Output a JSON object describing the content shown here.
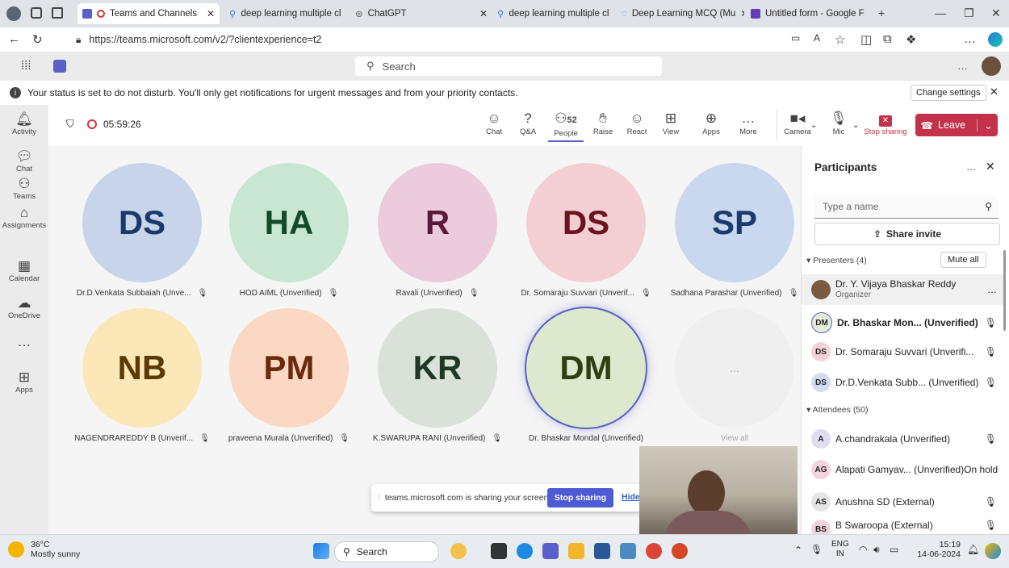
{
  "browser": {
    "tabs": [
      {
        "label": "Teams and Channels",
        "color": "#5b5fc7"
      },
      {
        "label": "deep learning multiple cl",
        "color": "#2a7de1"
      },
      {
        "label": "ChatGPT",
        "color": "#888888"
      },
      {
        "label": "deep learning multiple cl",
        "color": "#2a7de1"
      },
      {
        "label": "Deep Learning MCQ (Mu",
        "color": "#2a7de1"
      },
      {
        "label": "Untitled form - Google F",
        "color": "#673ab7"
      }
    ],
    "url": "https://teams.microsoft.com/v2/?clientexperience=t2"
  },
  "teams": {
    "search_placeholder": "Search"
  },
  "banner": {
    "text": "Your status is set to do not disturb. You'll only get notifications for urgent messages and from your priority contacts.",
    "button": "Change settings"
  },
  "rail": [
    {
      "label": "Activity",
      "icon": "bell-icon"
    },
    {
      "label": "Chat",
      "icon": "chat-icon"
    },
    {
      "label": "Teams",
      "icon": "teams-icon"
    },
    {
      "label": "Assignments",
      "icon": "assignments-icon"
    },
    {
      "label": "Calendar",
      "icon": "calendar-icon"
    },
    {
      "label": "OneDrive",
      "icon": "cloud-icon"
    },
    {
      "label": "Apps",
      "icon": "apps-icon"
    }
  ],
  "meeting": {
    "timer": "05:59:26",
    "people_count": "52",
    "buttons": [
      "Chat",
      "Q&A",
      "People",
      "Raise",
      "React",
      "View",
      "Apps",
      "More",
      "Camera",
      "Mic",
      "Stop sharing"
    ],
    "leave": "Leave"
  },
  "tiles": [
    {
      "initials": "DS",
      "name": "Dr.D.Venkata Subbaiah (Unve...",
      "bg": "#c8d4ea",
      "fg": "#1b3a6b"
    },
    {
      "initials": "HA",
      "name": "HOD AIML (Unverified)",
      "bg": "#c9e6d3",
      "fg": "#134a2a"
    },
    {
      "initials": "R",
      "name": "Ravali (Unverified)",
      "bg": "#ecccdc",
      "fg": "#5c1a3b"
    },
    {
      "initials": "DS",
      "name": "Dr. Somaraju Suvvari (Unverif...",
      "bg": "#f3cfd4",
      "fg": "#6b1320"
    },
    {
      "initials": "SP",
      "name": "Sadhana Parashar (Unverified)",
      "bg": "#c9d7ef",
      "fg": "#1b3a6b"
    },
    {
      "initials": "NB",
      "name": "NAGENDRAREDDY B (Unverif...",
      "bg": "#fbe7b8",
      "fg": "#5a3a05"
    },
    {
      "initials": "PM",
      "name": "praveena Murala (Unverified)",
      "bg": "#fbd8c3",
      "fg": "#6b2a0d"
    },
    {
      "initials": "KR",
      "name": "K.SWARUPA RANI (Unverified)",
      "bg": "#d9e1d9",
      "fg": "#1e3a24"
    },
    {
      "initials": "DM",
      "name": "Dr. Bhaskar Mondal (Unverified)",
      "bg": "#dde8cf",
      "fg": "#2f3f12"
    },
    {
      "initials": "...",
      "name": "View all",
      "bg": "#efefef",
      "fg": "#aaaaaa"
    }
  ],
  "share_notice": {
    "text": "teams.microsoft.com is sharing your screen.",
    "stop": "Stop sharing",
    "hide": "Hide"
  },
  "panel": {
    "title": "Participants",
    "search_placeholder": "Type a name",
    "share_invite": "Share invite",
    "presenters_label": "Presenters (4)",
    "mute_all": "Mute all",
    "presenters": [
      {
        "name": "Dr. Y. Vijaya Bhaskar Reddy",
        "role": "Organizer",
        "initials": "",
        "bg": "#7a5a40"
      },
      {
        "name": "Dr. Bhaskar Mon... (Unverified)",
        "initials": "DM",
        "bg": "#e4ecd8"
      },
      {
        "name": "Dr. Somaraju Suvvari (Unverifi...",
        "initials": "DS",
        "bg": "#f3d3d7"
      },
      {
        "name": "Dr.D.Venkata Subb... (Unverified)",
        "initials": "DS",
        "bg": "#d3ddef"
      }
    ],
    "attendees_label": "Attendees (50)",
    "attendees": [
      {
        "name": "A.chandrakala (Unverified)",
        "initials": "A",
        "bg": "#e2dcf0"
      },
      {
        "name": "Alapati Gamyav... (Unverified)",
        "status": "On hold",
        "initials": "AG",
        "bg": "#f3d3dc"
      },
      {
        "name": "Anushna SD (External)",
        "initials": "AS",
        "bg": "#e5e5e5"
      },
      {
        "name": "B Swaroopa (External)",
        "initials": "BS",
        "bg": "#f3d3dc"
      }
    ]
  },
  "taskbar": {
    "weather_temp": "36°C",
    "weather_desc": "Mostly sunny",
    "search": "Search",
    "lang": "ENG",
    "region": "IN",
    "time": "15:19",
    "date": "14-06-2024"
  }
}
